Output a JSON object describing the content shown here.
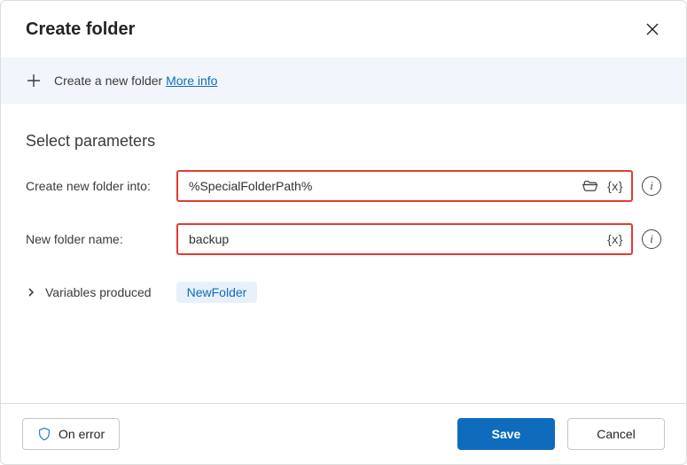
{
  "header": {
    "title": "Create folder"
  },
  "banner": {
    "text": "Create a new folder",
    "more_info_label": "More info"
  },
  "section": {
    "title": "Select parameters"
  },
  "fields": {
    "into": {
      "label": "Create new folder into:",
      "value": "%SpecialFolderPath%"
    },
    "name": {
      "label": "New folder name:",
      "value": "backup"
    }
  },
  "variables": {
    "label": "Variables produced",
    "chip": "NewFolder"
  },
  "footer": {
    "on_error": "On error",
    "save": "Save",
    "cancel": "Cancel"
  },
  "icons": {
    "var_token": "{x}"
  }
}
